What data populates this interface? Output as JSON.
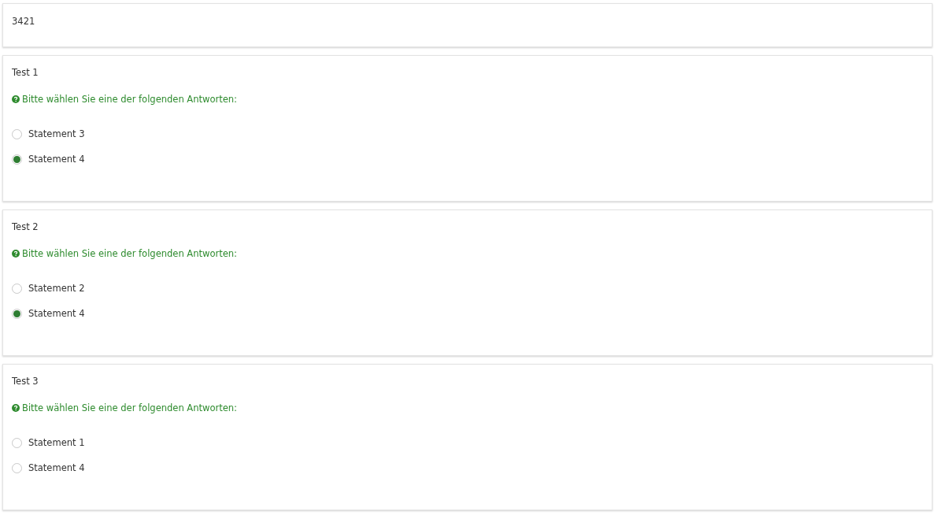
{
  "header": {
    "value": "3421"
  },
  "questions": [
    {
      "title": "Test 1",
      "hint": "Bitte wählen Sie eine der folgenden Antworten:",
      "options": [
        {
          "label": "Statement 3",
          "selected": false
        },
        {
          "label": "Statement 4",
          "selected": true
        }
      ]
    },
    {
      "title": "Test 2",
      "hint": "Bitte wählen Sie eine der folgenden Antworten:",
      "options": [
        {
          "label": "Statement 2",
          "selected": false
        },
        {
          "label": "Statement 4",
          "selected": true
        }
      ]
    },
    {
      "title": "Test 3",
      "hint": "Bitte wählen Sie eine der folgenden Antworten:",
      "options": [
        {
          "label": "Statement 1",
          "selected": false
        },
        {
          "label": "Statement 4",
          "selected": false
        }
      ]
    }
  ]
}
